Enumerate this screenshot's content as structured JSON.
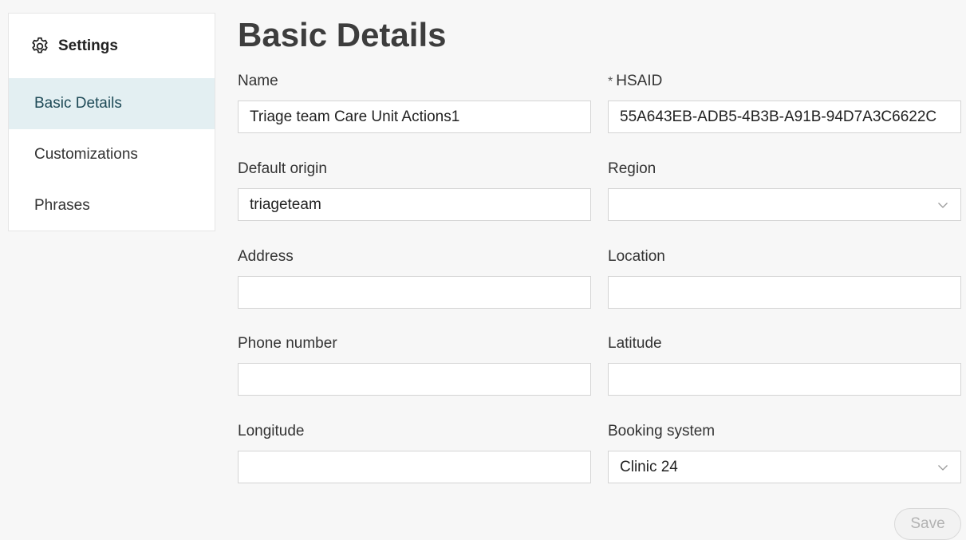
{
  "sidebar": {
    "title": "Settings",
    "title_icon": "gear-icon",
    "items": [
      {
        "label": "Basic Details",
        "active": true
      },
      {
        "label": "Customizations",
        "active": false
      },
      {
        "label": "Phrases",
        "active": false
      }
    ]
  },
  "main": {
    "title": "Basic Details",
    "fields": {
      "name": {
        "label": "Name",
        "value": "Triage team Care Unit Actions1"
      },
      "hsaid": {
        "label": "HSAID",
        "required_mark": "*",
        "value": "55A643EB-ADB5-4B3B-A91B-94D7A3C6622C"
      },
      "default_origin": {
        "label": "Default origin",
        "value": "triageteam"
      },
      "region": {
        "label": "Region",
        "value": ""
      },
      "address": {
        "label": "Address",
        "value": ""
      },
      "location": {
        "label": "Location",
        "value": ""
      },
      "phone_number": {
        "label": "Phone number",
        "value": ""
      },
      "latitude": {
        "label": "Latitude",
        "value": ""
      },
      "longitude": {
        "label": "Longitude",
        "value": ""
      },
      "booking_system": {
        "label": "Booking system",
        "value": "Clinic 24"
      }
    },
    "save_label": "Save"
  },
  "colors": {
    "active_item_bg": "#e3eff2",
    "active_item_text": "#1e4a57",
    "page_bg": "#f7f7f7"
  }
}
